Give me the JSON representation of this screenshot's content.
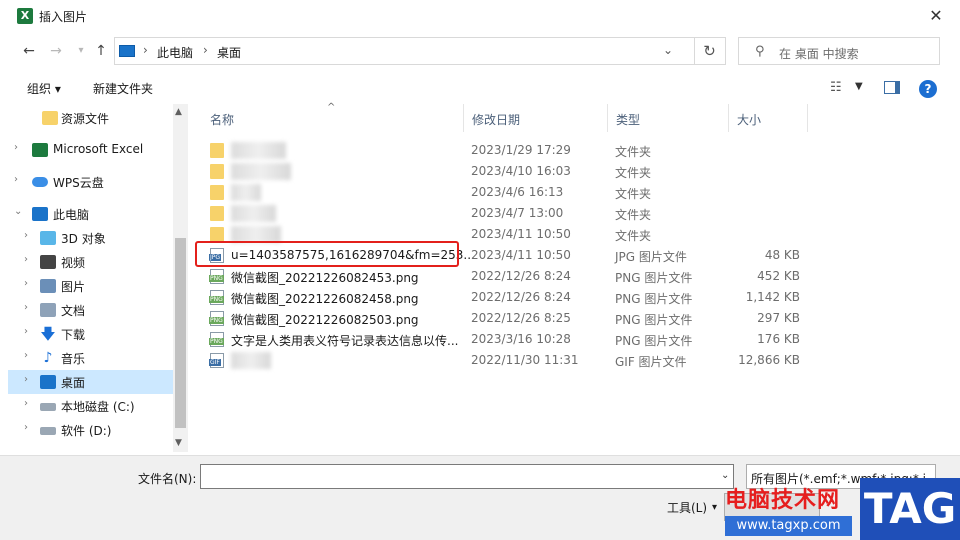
{
  "window": {
    "title": "插入图片"
  },
  "address": {
    "segments": [
      "此电脑",
      "桌面"
    ],
    "separator": "›",
    "search_placeholder": "在 桌面 中搜索"
  },
  "toolbar": {
    "organize": "组织 ▾",
    "new_folder": "新建文件夹"
  },
  "nav": {
    "items": [
      {
        "label": "资源文件",
        "icon": "folder-icon"
      },
      {
        "label": "Microsoft Excel",
        "icon": "excel-icon"
      },
      {
        "label": "WPS云盘",
        "icon": "cloud-icon"
      },
      {
        "label": "此电脑",
        "icon": "pc-icon"
      },
      {
        "label": "3D 对象",
        "icon": "cube-icon"
      },
      {
        "label": "视频",
        "icon": "video-icon"
      },
      {
        "label": "图片",
        "icon": "picture-icon"
      },
      {
        "label": "文档",
        "icon": "document-icon"
      },
      {
        "label": "下载",
        "icon": "download-icon"
      },
      {
        "label": "音乐",
        "icon": "music-icon"
      },
      {
        "label": "桌面",
        "icon": "desktop-icon"
      },
      {
        "label": "本地磁盘 (C:)",
        "icon": "drive-icon"
      },
      {
        "label": "软件 (D:)",
        "icon": "drive-icon"
      }
    ]
  },
  "columns": {
    "name": "名称",
    "date": "修改日期",
    "type": "类型",
    "size": "大小"
  },
  "files": [
    {
      "name": "",
      "date": "2023/1/29 17:29",
      "type": "文件夹",
      "size": "",
      "kind": "folder"
    },
    {
      "name": "",
      "date": "2023/4/10 16:03",
      "type": "文件夹",
      "size": "",
      "kind": "folder"
    },
    {
      "name": "",
      "date": "2023/4/6 16:13",
      "type": "文件夹",
      "size": "",
      "kind": "folder"
    },
    {
      "name": "",
      "date": "2023/4/7 13:00",
      "type": "文件夹",
      "size": "",
      "kind": "folder"
    },
    {
      "name": "",
      "date": "2023/4/11 10:50",
      "type": "文件夹",
      "size": "",
      "kind": "folder"
    },
    {
      "name": "u=1403587575,1616289704&fm=253...",
      "date": "2023/4/11 10:50",
      "type": "JPG 图片文件",
      "size": "48 KB",
      "kind": "jpg"
    },
    {
      "name": "微信截图_20221226082453.png",
      "date": "2022/12/26 8:24",
      "type": "PNG 图片文件",
      "size": "452 KB",
      "kind": "png"
    },
    {
      "name": "微信截图_20221226082458.png",
      "date": "2022/12/26 8:24",
      "type": "PNG 图片文件",
      "size": "1,142 KB",
      "kind": "png"
    },
    {
      "name": "微信截图_20221226082503.png",
      "date": "2022/12/26 8:25",
      "type": "PNG 图片文件",
      "size": "297 KB",
      "kind": "png"
    },
    {
      "name": "文字是人类用表义符号记录表达信息以传...",
      "date": "2023/3/16 10:28",
      "type": "PNG 图片文件",
      "size": "176 KB",
      "kind": "png"
    },
    {
      "name": "",
      "date": "2022/11/30 11:31",
      "type": "GIF 图片文件",
      "size": "12,866 KB",
      "kind": "gif"
    }
  ],
  "bottom": {
    "filename_label": "文件名(N):",
    "filename_value": "",
    "filter": "所有图片(*.emf;*.wmf;*.jpg;*.j",
    "tools": "工具(L)"
  },
  "watermark": {
    "text": "电脑技术网",
    "url": "www.tagxp.com",
    "tag": "TAG"
  },
  "colors": {
    "selection": "#cce8ff",
    "highlight": "#e3201b",
    "accent": "#1c6ed1"
  }
}
